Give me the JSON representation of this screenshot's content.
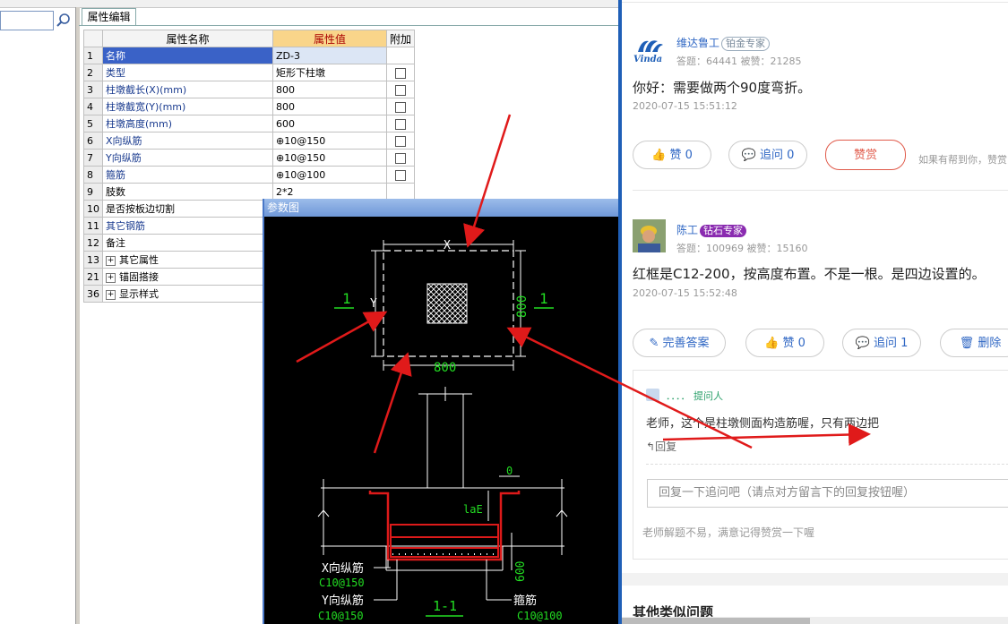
{
  "left_panel": {
    "tab_label": "属性编辑",
    "columns": [
      "属性名称",
      "属性值",
      "附加"
    ],
    "rows": [
      {
        "num": "1",
        "name": "名称",
        "value": "ZD-3",
        "check": false
      },
      {
        "num": "2",
        "name": "类型",
        "value": "矩形下柱墩",
        "check": true
      },
      {
        "num": "3",
        "name": "柱墩截长(X)(mm)",
        "value": "800",
        "check": true
      },
      {
        "num": "4",
        "name": "柱墩截宽(Y)(mm)",
        "value": "800",
        "check": true
      },
      {
        "num": "5",
        "name": "柱墩高度(mm)",
        "value": "600",
        "check": true
      },
      {
        "num": "6",
        "name": "X向纵筋",
        "value": "⊕10@150",
        "check": true
      },
      {
        "num": "7",
        "name": "Y向纵筋",
        "value": "⊕10@150",
        "check": true
      },
      {
        "num": "8",
        "name": "箍筋",
        "value": "⊕10@100",
        "check": true
      },
      {
        "num": "9",
        "name": "肢数",
        "value": "2*2",
        "check": false
      },
      {
        "num": "10",
        "name": "是否按板边切割",
        "value": "",
        "check": false
      },
      {
        "num": "11",
        "name": "其它钢筋",
        "value": "",
        "check": false
      },
      {
        "num": "12",
        "name": "备注",
        "value": "",
        "check": false
      },
      {
        "num": "13",
        "name": "其它属性",
        "value": "",
        "check": false
      },
      {
        "num": "21",
        "name": "锚固搭接",
        "value": "",
        "check": false
      },
      {
        "num": "36",
        "name": "显示样式",
        "value": "",
        "check": false
      }
    ]
  },
  "dialog": {
    "title": "参数图",
    "labels": {
      "x": "X",
      "y": "Y",
      "section_left": "1",
      "section_right": "1",
      "dim_800_bottom": "800",
      "dim_800_right": "800",
      "dim_0": "0",
      "lae": "laE",
      "dim_600": "600",
      "x_bar_label": "X向纵筋",
      "x_bar_spec": "C10@150",
      "y_bar_label": "Y向纵筋",
      "y_bar_spec": "C10@150",
      "stirrup_label": "箍筋",
      "stirrup_spec": "C10@100",
      "section_title": "1-1"
    }
  },
  "qa": {
    "answer1": {
      "user": "维达鲁工",
      "badge": "铂金专家",
      "stats": "答题：64441    被赞：21285",
      "text": "你好：需要做两个90度弯折。",
      "time": "2020-07-15 15:51:12",
      "like": "赞 0",
      "follow": "追问  0",
      "reward": "赞赏",
      "hint": "如果有帮到你，赞赏"
    },
    "answer2": {
      "user": "陈工",
      "badge": "钻石专家",
      "stats": "答题：100969    被赞：15160",
      "text": "红框是C12-200，按高度布置。不是一根。是四边设置的。",
      "time": "2020-07-15 15:52:48",
      "improve": "完善答案",
      "like": "赞 0",
      "follow": "追问 1",
      "delete": "删除"
    },
    "followup": {
      "user": "．．．．",
      "role": "提问人",
      "text": "老师，这个是柱墩侧面构造筋喔，只有两边把",
      "reply": "回复",
      "input_placeholder": "回复一下追问吧（请点对方留言下的回复按钮喔）",
      "footer": "老师解题不易，满意记得赞赏一下喔"
    },
    "similar_title": "其他类似问题"
  },
  "colors": {
    "accent": "#2f67c4",
    "reward": "#e05a4a",
    "arrow": "#e01a1a",
    "cad_green": "#22dd22",
    "cad_rebar": "#dd1a1a"
  }
}
